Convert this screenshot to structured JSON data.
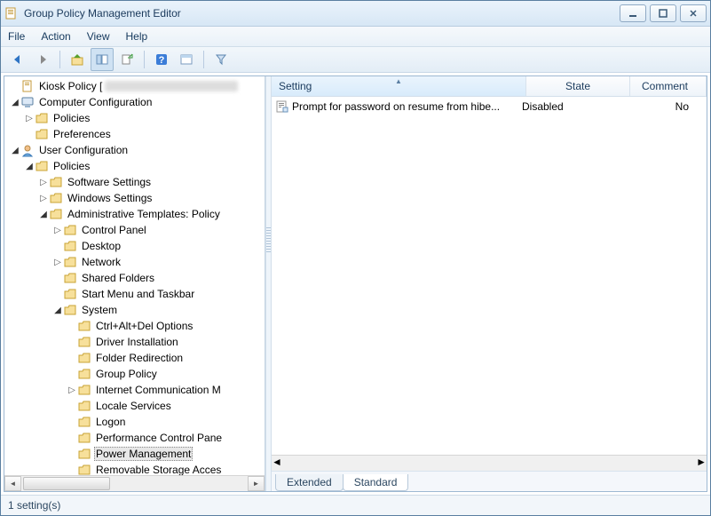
{
  "window": {
    "title": "Group Policy Management Editor"
  },
  "menu": {
    "file": "File",
    "action": "Action",
    "view": "View",
    "help": "Help"
  },
  "tree": [
    {
      "depth": 0,
      "twisty": "",
      "icon": "doc",
      "label": "Kiosk Policy [",
      "tail_blur": true
    },
    {
      "depth": 0,
      "twisty": "▲",
      "icon": "computer",
      "label": "Computer Configuration"
    },
    {
      "depth": 1,
      "twisty": "▷",
      "icon": "folder",
      "label": "Policies"
    },
    {
      "depth": 1,
      "twisty": "",
      "icon": "folder",
      "label": "Preferences"
    },
    {
      "depth": 0,
      "twisty": "▲",
      "icon": "user",
      "label": "User Configuration"
    },
    {
      "depth": 1,
      "twisty": "▲",
      "icon": "folder",
      "label": "Policies"
    },
    {
      "depth": 2,
      "twisty": "▷",
      "icon": "folder",
      "label": "Software Settings"
    },
    {
      "depth": 2,
      "twisty": "▷",
      "icon": "folder",
      "label": "Windows Settings"
    },
    {
      "depth": 2,
      "twisty": "▲",
      "icon": "folder",
      "label": "Administrative Templates: Policy"
    },
    {
      "depth": 3,
      "twisty": "▷",
      "icon": "folder",
      "label": "Control Panel"
    },
    {
      "depth": 3,
      "twisty": "",
      "icon": "folder",
      "label": "Desktop"
    },
    {
      "depth": 3,
      "twisty": "▷",
      "icon": "folder",
      "label": "Network"
    },
    {
      "depth": 3,
      "twisty": "",
      "icon": "folder",
      "label": "Shared Folders"
    },
    {
      "depth": 3,
      "twisty": "",
      "icon": "folder",
      "label": "Start Menu and Taskbar"
    },
    {
      "depth": 3,
      "twisty": "▲",
      "icon": "folder",
      "label": "System"
    },
    {
      "depth": 4,
      "twisty": "",
      "icon": "folder",
      "label": "Ctrl+Alt+Del Options"
    },
    {
      "depth": 4,
      "twisty": "",
      "icon": "folder",
      "label": "Driver Installation"
    },
    {
      "depth": 4,
      "twisty": "",
      "icon": "folder",
      "label": "Folder Redirection"
    },
    {
      "depth": 4,
      "twisty": "",
      "icon": "folder",
      "label": "Group Policy"
    },
    {
      "depth": 4,
      "twisty": "▷",
      "icon": "folder",
      "label": "Internet Communication M"
    },
    {
      "depth": 4,
      "twisty": "",
      "icon": "folder",
      "label": "Locale Services"
    },
    {
      "depth": 4,
      "twisty": "",
      "icon": "folder",
      "label": "Logon"
    },
    {
      "depth": 4,
      "twisty": "",
      "icon": "folder",
      "label": "Performance Control Pane"
    },
    {
      "depth": 4,
      "twisty": "",
      "icon": "folder",
      "label": "Power Management",
      "selected": true
    },
    {
      "depth": 4,
      "twisty": "",
      "icon": "folder",
      "label": "Removable Storage Acces"
    }
  ],
  "list": {
    "columns": [
      "Setting",
      "State",
      "Comment"
    ],
    "rows": [
      {
        "setting": "Prompt for password on resume from hibe...",
        "state": "Disabled",
        "comment": "No"
      }
    ]
  },
  "tabs": {
    "extended": "Extended",
    "standard": "Standard"
  },
  "status": {
    "text": "1 setting(s)"
  }
}
